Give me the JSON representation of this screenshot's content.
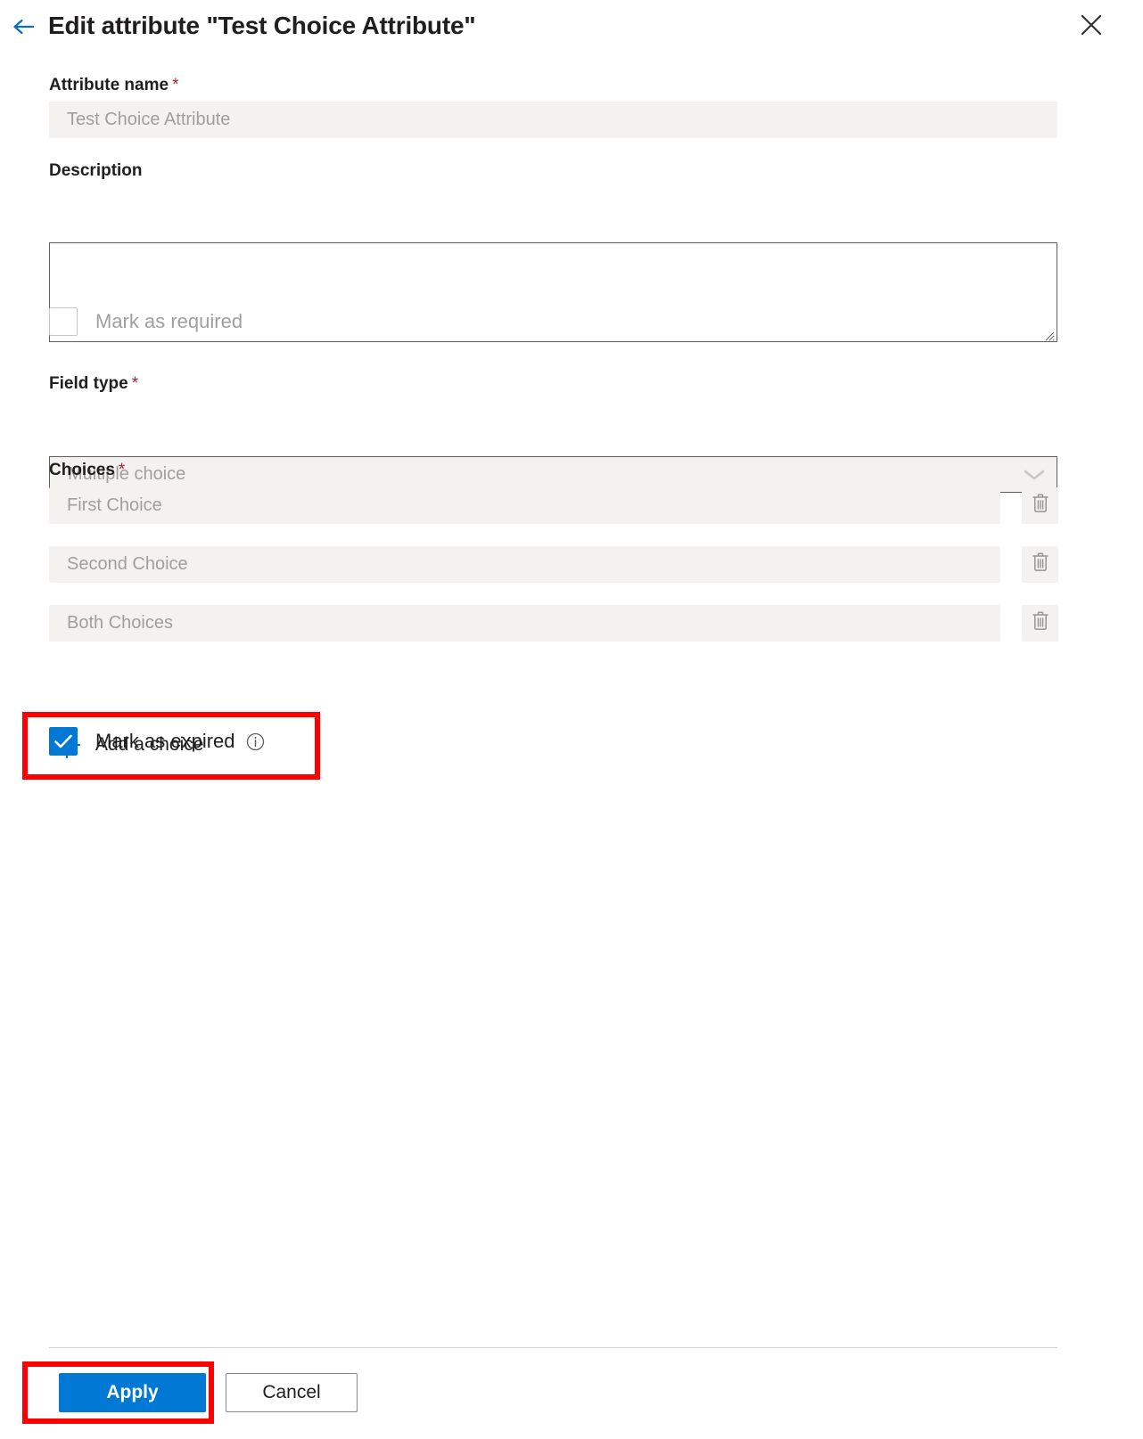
{
  "header": {
    "back_icon": "back-arrow-icon",
    "title": "Edit attribute \"Test Choice Attribute\"",
    "close_icon": "close-icon"
  },
  "colors": {
    "accent_blue": "#0078D4",
    "required_star": "#A4262C",
    "annotation_red": "#FF0000",
    "disabled_text": "#A19F9D",
    "field_fill": "#F3F2F1",
    "border_dark": "#605E5C"
  },
  "form": {
    "attribute_name": {
      "label": "Attribute name",
      "required_marker": "*",
      "value": "Test Choice Attribute",
      "placeholder": "Test Choice Attribute",
      "disabled": true
    },
    "description": {
      "label": "Description",
      "value": "",
      "placeholder": "",
      "disabled": false
    },
    "mark_as_required": {
      "label": "Mark as required",
      "checked": false,
      "disabled": true
    },
    "field_type": {
      "label": "Field type",
      "required_marker": "*",
      "value": "Multiple choice",
      "chevron_icon": "chevron-down-icon",
      "disabled": true,
      "options": [
        "Multiple choice"
      ]
    },
    "choices": {
      "label": "Choices",
      "required_marker": "*",
      "items": [
        {
          "value": "First Choice",
          "delete_icon": "trash-icon"
        },
        {
          "value": "Second Choice",
          "delete_icon": "trash-icon"
        },
        {
          "value": "Both Choices",
          "delete_icon": "trash-icon"
        }
      ],
      "add_label": "Add a choice",
      "add_icon": "plus-icon"
    },
    "mark_as_expired": {
      "label": "Mark as expired",
      "checked": true,
      "disabled": false,
      "info_icon": "info-icon",
      "highlighted": true
    }
  },
  "footer": {
    "apply_label": "Apply",
    "cancel_label": "Cancel",
    "apply_highlighted": true
  }
}
